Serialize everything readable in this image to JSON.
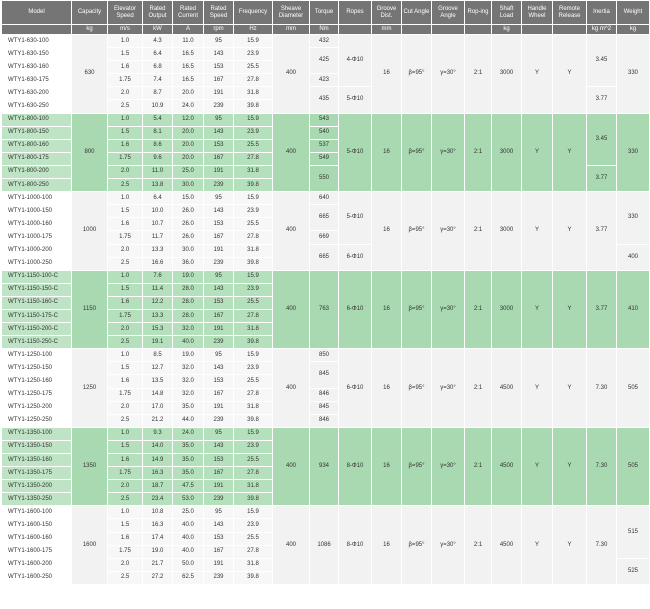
{
  "headers": [
    {
      "label": "Model",
      "unit": ""
    },
    {
      "label": "Capacity",
      "unit": "kg"
    },
    {
      "label": "Elevator Speed",
      "unit": "m/s"
    },
    {
      "label": "Rated Output",
      "unit": "kW"
    },
    {
      "label": "Rated Current",
      "unit": "A"
    },
    {
      "label": "Rated Speed",
      "unit": "rpm"
    },
    {
      "label": "Frequency",
      "unit": "Hz"
    },
    {
      "label": "Sheave Diameter",
      "unit": "mm"
    },
    {
      "label": "Torque",
      "unit": "Nm"
    },
    {
      "label": "Ropes",
      "unit": ""
    },
    {
      "label": "Groove Dist.",
      "unit": "mm"
    },
    {
      "label": "Cut Angle",
      "unit": ""
    },
    {
      "label": "Groove Angle",
      "unit": ""
    },
    {
      "label": "Rop-ing",
      "unit": ""
    },
    {
      "label": "Shaft Load",
      "unit": "kg"
    },
    {
      "label": "Handle Wheel",
      "unit": ""
    },
    {
      "label": "Remote Release",
      "unit": ""
    },
    {
      "label": "Inertia",
      "unit": "kg m^2"
    },
    {
      "label": "Weight",
      "unit": "kg"
    }
  ],
  "groups": [
    {
      "shade": "white",
      "capacity": "630",
      "sheave": "400",
      "groove_dist": "16",
      "cut_angle": "β=95°",
      "groove_angle": "γ=30°",
      "roping": "2:1",
      "shaft_load": "3000",
      "handle_wheel": "Y",
      "remote_release": "Y",
      "rows": [
        {
          "model": "WTY1-630-100",
          "speed": "1.0",
          "output": "4.3",
          "current": "11.0",
          "rpm": "95",
          "hz": "15.9"
        },
        {
          "model": "WTY1-630-150",
          "speed": "1.5",
          "output": "6.4",
          "current": "16.5",
          "rpm": "143",
          "hz": "23.9"
        },
        {
          "model": "WTY1-630-160",
          "speed": "1.6",
          "output": "6.8",
          "current": "16.5",
          "rpm": "153",
          "hz": "25.5"
        },
        {
          "model": "WTY1-630-175",
          "speed": "1.75",
          "output": "7.4",
          "current": "16.5",
          "rpm": "167",
          "hz": "27.8"
        },
        {
          "model": "WTY1-630-200",
          "speed": "2.0",
          "output": "8.7",
          "current": "20.0",
          "rpm": "191",
          "hz": "31.8"
        },
        {
          "model": "WTY1-630-250",
          "speed": "2.5",
          "output": "10.9",
          "current": "24.0",
          "rpm": "239",
          "hz": "39.8"
        }
      ],
      "torque": [
        {
          "value": "432",
          "span": 1
        },
        {
          "value": "425",
          "span": 2
        },
        {
          "value": "423",
          "span": 1
        },
        {
          "value": "435",
          "span": 2
        }
      ],
      "ropes": [
        {
          "value": "4-Φ10",
          "span": 4
        },
        {
          "value": "5-Φ10",
          "span": 2
        }
      ],
      "inertia": [
        {
          "value": "3.45",
          "span": 4
        },
        {
          "value": "3.77",
          "span": 2
        }
      ],
      "weight": [
        {
          "value": "330",
          "span": 6
        }
      ]
    },
    {
      "shade": "green",
      "capacity": "800",
      "sheave": "400",
      "groove_dist": "16",
      "cut_angle": "β=95°",
      "groove_angle": "γ=30°",
      "roping": "2:1",
      "shaft_load": "3000",
      "handle_wheel": "Y",
      "remote_release": "Y",
      "rows": [
        {
          "model": "WTY1-800-100",
          "speed": "1.0",
          "output": "5.4",
          "current": "12.0",
          "rpm": "95",
          "hz": "15.9"
        },
        {
          "model": "WTY1-800-150",
          "speed": "1.5",
          "output": "8.1",
          "current": "20.0",
          "rpm": "143",
          "hz": "23.9"
        },
        {
          "model": "WTY1-800-160",
          "speed": "1.6",
          "output": "8.6",
          "current": "20.0",
          "rpm": "153",
          "hz": "25.5"
        },
        {
          "model": "WTY1-800-175",
          "speed": "1.75",
          "output": "9.6",
          "current": "20.0",
          "rpm": "167",
          "hz": "27.8"
        },
        {
          "model": "WTY1-800-200",
          "speed": "2.0",
          "output": "11.0",
          "current": "25.0",
          "rpm": "191",
          "hz": "31.8"
        },
        {
          "model": "WTY1-800-250",
          "speed": "2.5",
          "output": "13.8",
          "current": "30.0",
          "rpm": "239",
          "hz": "39.8"
        }
      ],
      "torque": [
        {
          "value": "543",
          "span": 1
        },
        {
          "value": "540",
          "span": 1
        },
        {
          "value": "537",
          "span": 1
        },
        {
          "value": "549",
          "span": 1
        },
        {
          "value": "550",
          "span": 2
        }
      ],
      "ropes": [
        {
          "value": "5-Φ10",
          "span": 6
        }
      ],
      "inertia": [
        {
          "value": "3.45",
          "span": 4
        },
        {
          "value": "3.77",
          "span": 2
        }
      ],
      "weight": [
        {
          "value": "330",
          "span": 6
        }
      ]
    },
    {
      "shade": "white",
      "capacity": "1000",
      "sheave": "400",
      "groove_dist": "16",
      "cut_angle": "β=95°",
      "groove_angle": "γ=30°",
      "roping": "2:1",
      "shaft_load": "3000",
      "handle_wheel": "Y",
      "remote_release": "Y",
      "rows": [
        {
          "model": "WTY1-1000-100",
          "speed": "1.0",
          "output": "6.4",
          "current": "15.0",
          "rpm": "95",
          "hz": "15.9"
        },
        {
          "model": "WTY1-1000-150",
          "speed": "1.5",
          "output": "10.0",
          "current": "26.0",
          "rpm": "143",
          "hz": "23.9"
        },
        {
          "model": "WTY1-1000-160",
          "speed": "1.6",
          "output": "10.7",
          "current": "26.0",
          "rpm": "153",
          "hz": "25.5"
        },
        {
          "model": "WTY1-1000-175",
          "speed": "1.75",
          "output": "11.7",
          "current": "26.0",
          "rpm": "167",
          "hz": "27.8"
        },
        {
          "model": "WTY1-1000-200",
          "speed": "2.0",
          "output": "13.3",
          "current": "30.0",
          "rpm": "191",
          "hz": "31.8"
        },
        {
          "model": "WTY1-1000-250",
          "speed": "2.5",
          "output": "16.6",
          "current": "36.0",
          "rpm": "239",
          "hz": "39.8"
        }
      ],
      "torque": [
        {
          "value": "640",
          "span": 1
        },
        {
          "value": "665",
          "span": 2
        },
        {
          "value": "669",
          "span": 1
        },
        {
          "value": "665",
          "span": 2
        }
      ],
      "ropes": [
        {
          "value": "5-Φ10",
          "span": 4
        },
        {
          "value": "6-Φ10",
          "span": 2
        }
      ],
      "inertia": [
        {
          "value": "3.77",
          "span": 6
        }
      ],
      "weight": [
        {
          "value": "330",
          "span": 4
        },
        {
          "value": "400",
          "span": 2
        }
      ]
    },
    {
      "shade": "green",
      "capacity": "1150",
      "sheave": "400",
      "groove_dist": "16",
      "cut_angle": "β=95°",
      "groove_angle": "γ=30°",
      "roping": "2:1",
      "shaft_load": "3000",
      "handle_wheel": "Y",
      "remote_release": "Y",
      "rows": [
        {
          "model": "WTY1-1150-100-C",
          "speed": "1.0",
          "output": "7.6",
          "current": "19.0",
          "rpm": "95",
          "hz": "15.9"
        },
        {
          "model": "WTY1-1150-150-C",
          "speed": "1.5",
          "output": "11.4",
          "current": "28.0",
          "rpm": "143",
          "hz": "23.9"
        },
        {
          "model": "WTY1-1150-160-C",
          "speed": "1.6",
          "output": "12.2",
          "current": "28.0",
          "rpm": "153",
          "hz": "25.5"
        },
        {
          "model": "WTY1-1150-175-C",
          "speed": "1.75",
          "output": "13.3",
          "current": "28.0",
          "rpm": "167",
          "hz": "27.8"
        },
        {
          "model": "WTY1-1150-200-C",
          "speed": "2.0",
          "output": "15.3",
          "current": "32.0",
          "rpm": "191",
          "hz": "31.8"
        },
        {
          "model": "WTY1-1150-250-C",
          "speed": "2.5",
          "output": "19.1",
          "current": "40.0",
          "rpm": "239",
          "hz": "39.8"
        }
      ],
      "torque": [
        {
          "value": "763",
          "span": 6
        }
      ],
      "ropes": [
        {
          "value": "6-Φ10",
          "span": 6
        }
      ],
      "inertia": [
        {
          "value": "3.77",
          "span": 6
        }
      ],
      "weight": [
        {
          "value": "410",
          "span": 6
        }
      ]
    },
    {
      "shade": "white",
      "capacity": "1250",
      "sheave": "400",
      "groove_dist": "16",
      "cut_angle": "β=95°",
      "groove_angle": "γ=30°",
      "roping": "2:1",
      "shaft_load": "4500",
      "handle_wheel": "Y",
      "remote_release": "Y",
      "rows": [
        {
          "model": "WTY1-1250-100",
          "speed": "1.0",
          "output": "8.5",
          "current": "19.0",
          "rpm": "95",
          "hz": "15.9"
        },
        {
          "model": "WTY1-1250-150",
          "speed": "1.5",
          "output": "12.7",
          "current": "32.0",
          "rpm": "143",
          "hz": "23.9"
        },
        {
          "model": "WTY1-1250-160",
          "speed": "1.6",
          "output": "13.5",
          "current": "32.0",
          "rpm": "153",
          "hz": "25.5"
        },
        {
          "model": "WTY1-1250-175",
          "speed": "1.75",
          "output": "14.8",
          "current": "32.0",
          "rpm": "167",
          "hz": "27.8"
        },
        {
          "model": "WTY1-1250-200",
          "speed": "2.0",
          "output": "17.0",
          "current": "35.0",
          "rpm": "191",
          "hz": "31.8"
        },
        {
          "model": "WTY1-1250-250",
          "speed": "2.5",
          "output": "21.2",
          "current": "44.0",
          "rpm": "239",
          "hz": "39.8"
        }
      ],
      "torque": [
        {
          "value": "850",
          "span": 1
        },
        {
          "value": "845",
          "span": 2
        },
        {
          "value": "846",
          "span": 1
        },
        {
          "value": "845",
          "span": 1
        },
        {
          "value": "846",
          "span": 1
        }
      ],
      "ropes": [
        {
          "value": "6-Φ10",
          "span": 6
        }
      ],
      "inertia": [
        {
          "value": "7.30",
          "span": 6
        }
      ],
      "weight": [
        {
          "value": "505",
          "span": 6
        }
      ]
    },
    {
      "shade": "green",
      "capacity": "1350",
      "sheave": "400",
      "groove_dist": "16",
      "cut_angle": "β=95°",
      "groove_angle": "γ=30°",
      "roping": "2:1",
      "shaft_load": "4500",
      "handle_wheel": "Y",
      "remote_release": "Y",
      "rows": [
        {
          "model": "WTY1-1350-100",
          "speed": "1.0",
          "output": "9.3",
          "current": "24.0",
          "rpm": "95",
          "hz": "15.9"
        },
        {
          "model": "WTY1-1350-150",
          "speed": "1.5",
          "output": "14.0",
          "current": "35.0",
          "rpm": "143",
          "hz": "23.9"
        },
        {
          "model": "WTY1-1350-160",
          "speed": "1.6",
          "output": "14.9",
          "current": "35.0",
          "rpm": "153",
          "hz": "25.5"
        },
        {
          "model": "WTY1-1350-175",
          "speed": "1.75",
          "output": "16.3",
          "current": "35.0",
          "rpm": "167",
          "hz": "27.8"
        },
        {
          "model": "WTY1-1350-200",
          "speed": "2.0",
          "output": "18.7",
          "current": "47.5",
          "rpm": "191",
          "hz": "31.8"
        },
        {
          "model": "WTY1-1350-250",
          "speed": "2.5",
          "output": "23.4",
          "current": "53.0",
          "rpm": "239",
          "hz": "39.8"
        }
      ],
      "torque": [
        {
          "value": "934",
          "span": 6
        }
      ],
      "ropes": [
        {
          "value": "8-Φ10",
          "span": 6
        }
      ],
      "inertia": [
        {
          "value": "7.30",
          "span": 6
        }
      ],
      "weight": [
        {
          "value": "505",
          "span": 6
        }
      ]
    },
    {
      "shade": "white",
      "capacity": "1600",
      "sheave": "400",
      "groove_dist": "16",
      "cut_angle": "β=95°",
      "groove_angle": "γ=30°",
      "roping": "2:1",
      "shaft_load": "4500",
      "handle_wheel": "Y",
      "remote_release": "Y",
      "rows": [
        {
          "model": "WTY1-1600-100",
          "speed": "1.0",
          "output": "10.8",
          "current": "25.0",
          "rpm": "95",
          "hz": "15.9"
        },
        {
          "model": "WTY1-1600-150",
          "speed": "1.5",
          "output": "16.3",
          "current": "40.0",
          "rpm": "143",
          "hz": "23.9"
        },
        {
          "model": "WTY1-1600-160",
          "speed": "1.6",
          "output": "17.4",
          "current": "40.0",
          "rpm": "153",
          "hz": "25.5"
        },
        {
          "model": "WTY1-1600-175",
          "speed": "1.75",
          "output": "19.0",
          "current": "40.0",
          "rpm": "167",
          "hz": "27.8"
        },
        {
          "model": "WTY1-1600-200",
          "speed": "2.0",
          "output": "21.7",
          "current": "50.0",
          "rpm": "191",
          "hz": "31.8"
        },
        {
          "model": "WTY1-1600-250",
          "speed": "2.5",
          "output": "27.2",
          "current": "62.5",
          "rpm": "239",
          "hz": "39.8"
        }
      ],
      "torque": [
        {
          "value": "1086",
          "span": 6
        }
      ],
      "ropes": [
        {
          "value": "8-Φ10",
          "span": 6
        }
      ],
      "inertia": [
        {
          "value": "7.30",
          "span": 6
        }
      ],
      "weight": [
        {
          "value": "515",
          "span": 4
        },
        {
          "value": "525",
          "span": 2
        }
      ]
    }
  ]
}
